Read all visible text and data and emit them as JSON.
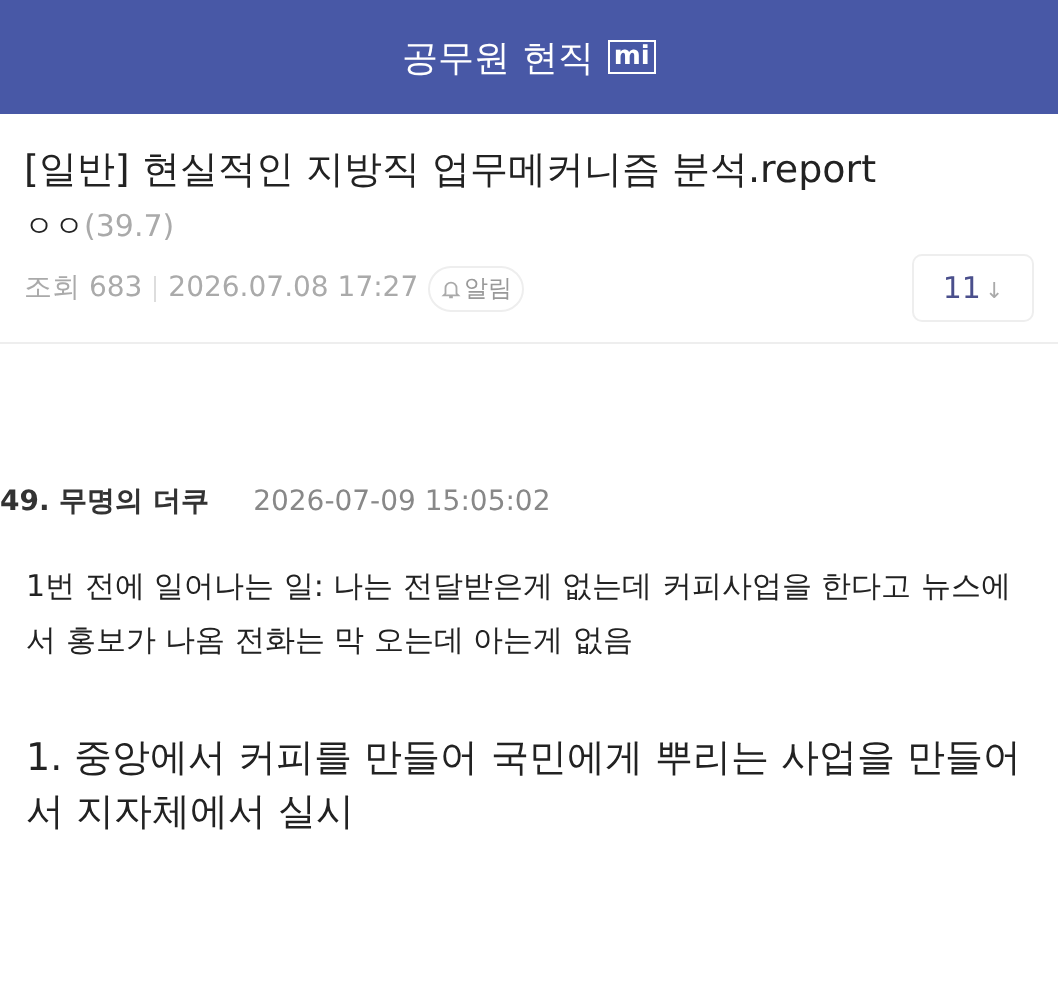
{
  "header": {
    "title": "공무원 현직",
    "logo": "mi"
  },
  "post": {
    "title": "[일반] 현실적인 지방직 업무메커니즘 분석.report",
    "author": "ㅇㅇ",
    "author_ip": "(39.7)",
    "views": "조회 683",
    "date": "2026.07.08 17:27",
    "alert": "알림",
    "comment_count": "11",
    "comment_arrow": "↓"
  },
  "comment": {
    "number": "49.",
    "author": "무명의 더쿠",
    "date": "2026-07-09 15:05:02",
    "body": "1번 전에 일어나는 일: 나는 전달받은게 없는데 커피사업을 한다고 뉴스에서 홍보가 나옴 전화는 막 오는데 아는게 없음",
    "point": "1. 중앙에서 커피를 만들어 국민에게 뿌리는 사업을 만들어서 지자체에서 실시"
  }
}
